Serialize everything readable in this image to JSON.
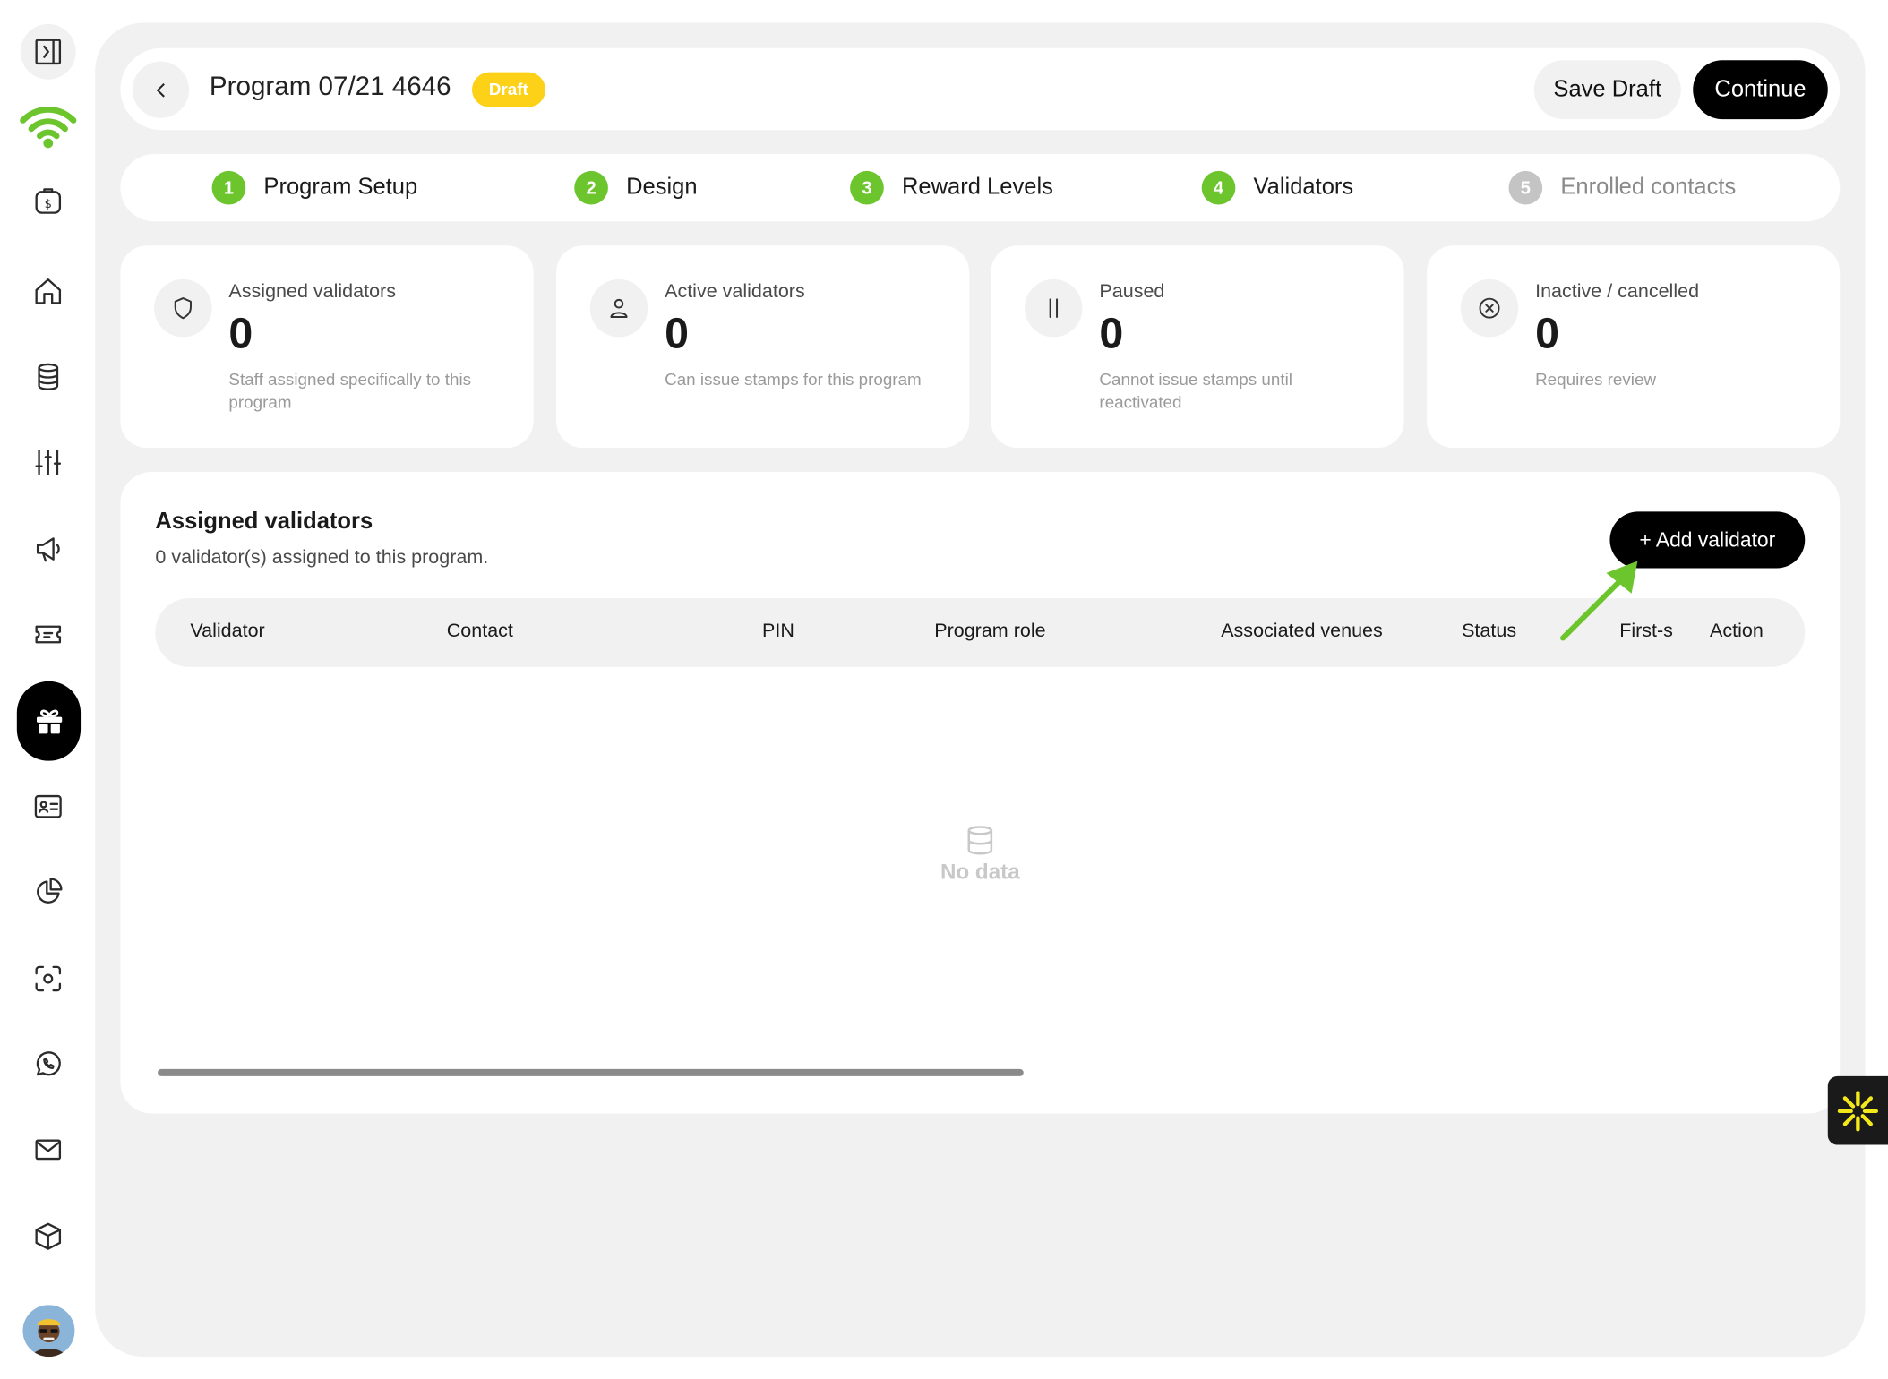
{
  "sidebar": {
    "icons": [
      "sidebar-toggle-icon",
      "wifi-logo-icon",
      "wallet-icon",
      "home-icon",
      "database-icon",
      "sliders-icon",
      "megaphone-icon",
      "ticket-icon",
      "gift-icon",
      "contact-card-icon",
      "pie-chart-icon",
      "scan-icon",
      "whatsapp-icon",
      "mail-icon",
      "box-icon",
      "avatar"
    ],
    "active": "gift-icon",
    "logo_color": "#6cc52d"
  },
  "header": {
    "title": "Program 07/21 4646",
    "badge": "Draft",
    "save_label": "Save Draft",
    "continue_label": "Continue"
  },
  "steps": [
    {
      "num": "1",
      "label": "Program Setup",
      "done": true
    },
    {
      "num": "2",
      "label": "Design",
      "done": true
    },
    {
      "num": "3",
      "label": "Reward Levels",
      "done": true
    },
    {
      "num": "4",
      "label": "Validators",
      "done": true
    },
    {
      "num": "5",
      "label": "Enrolled contacts",
      "done": false
    }
  ],
  "stats": [
    {
      "icon": "shield-icon",
      "label": "Assigned validators",
      "value": "0",
      "desc": "Staff assigned specifically to this program"
    },
    {
      "icon": "user-icon",
      "label": "Active validators",
      "value": "0",
      "desc": "Can issue stamps for this program"
    },
    {
      "icon": "pause-icon",
      "label": "Paused",
      "value": "0",
      "desc": "Cannot issue stamps until reactivated"
    },
    {
      "icon": "x-circle-icon",
      "label": "Inactive / cancelled",
      "value": "0",
      "desc": "Requires review"
    }
  ],
  "validators": {
    "title": "Assigned validators",
    "subtitle": "0 validator(s) assigned to this program.",
    "add_label": "+ Add validator",
    "columns": [
      "Validator",
      "Contact",
      "PIN",
      "Program role",
      "Associated venues",
      "Status",
      "First-s",
      "Action"
    ],
    "rows": [],
    "empty_text": "No data"
  },
  "colors": {
    "accent_green": "#6cc52d",
    "draft_yellow": "#fcd117",
    "panel_bg": "#f1f1f1",
    "inactive_step": "#c4c4c4"
  }
}
